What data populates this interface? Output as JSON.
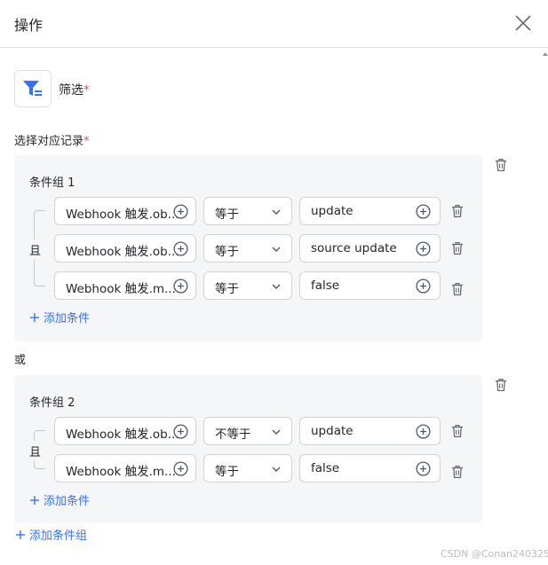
{
  "header": {
    "title": "操作"
  },
  "action": {
    "label": "筛选",
    "required_mark": "*"
  },
  "section": {
    "label": "选择对应记录",
    "required_mark": "*"
  },
  "or_label": "或",
  "groups": [
    {
      "title": "条件组 1",
      "connector": "且",
      "add_condition": "添加条件",
      "rows": [
        {
          "field": "Webhook 触发.ob...",
          "operator": "等于",
          "value": "update"
        },
        {
          "field": "Webhook 触发.ob...",
          "operator": "等于",
          "value": "source update"
        },
        {
          "field": "Webhook 触发.m...",
          "operator": "等于",
          "value": "false"
        }
      ]
    },
    {
      "title": "条件组 2",
      "connector": "且",
      "add_condition": "添加条件",
      "rows": [
        {
          "field": "Webhook 触发.ob...",
          "operator": "不等于",
          "value": "update"
        },
        {
          "field": "Webhook 触发.m...",
          "operator": "等于",
          "value": "false"
        }
      ]
    }
  ],
  "add_group": "添加条件组",
  "watermark": "CSDN @Conan240325",
  "colors": {
    "accent": "#3370ff",
    "required": "#f54a45",
    "group_bg": "#f5f6f7",
    "border": "#d0d3d6"
  },
  "icons": [
    "close-icon",
    "filter-icon",
    "trash-icon",
    "plus-circle-icon",
    "chevron-down-icon",
    "plus-icon"
  ]
}
